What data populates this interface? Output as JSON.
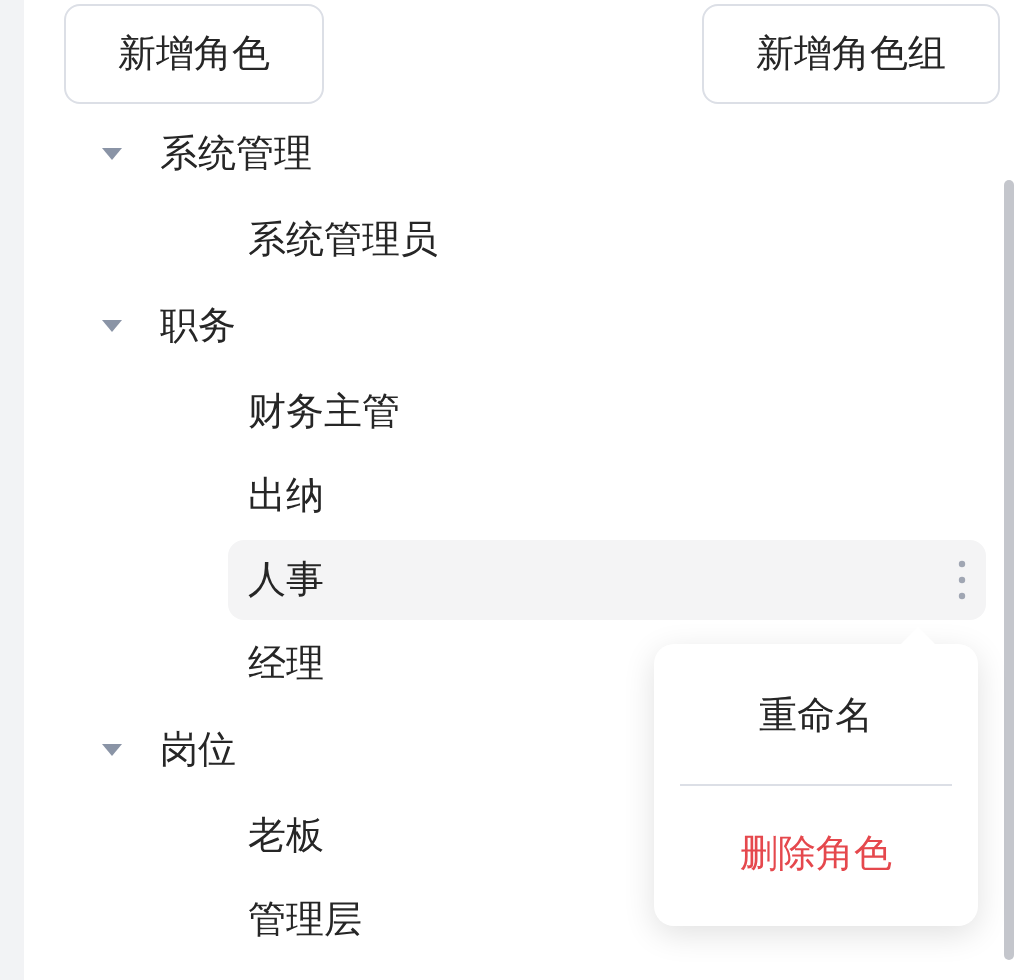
{
  "toolbar": {
    "buttons": [
      {
        "label": "新增角色"
      },
      {
        "label": "新增角色组"
      }
    ]
  },
  "tree": [
    {
      "label": "系统管理",
      "expanded": true,
      "children": [
        {
          "label": "系统管理员",
          "selected": false
        }
      ]
    },
    {
      "label": "职务",
      "expanded": true,
      "children": [
        {
          "label": "财务主管",
          "selected": false
        },
        {
          "label": "出纳",
          "selected": false
        },
        {
          "label": "人事",
          "selected": true
        },
        {
          "label": "经理",
          "selected": false
        }
      ]
    },
    {
      "label": "岗位",
      "expanded": true,
      "children": [
        {
          "label": "老板",
          "selected": false
        },
        {
          "label": "管理层",
          "selected": false
        }
      ]
    }
  ],
  "context_menu": {
    "items": [
      {
        "label": "重命名",
        "kind": "normal"
      },
      {
        "label": "删除角色",
        "kind": "danger"
      }
    ]
  }
}
